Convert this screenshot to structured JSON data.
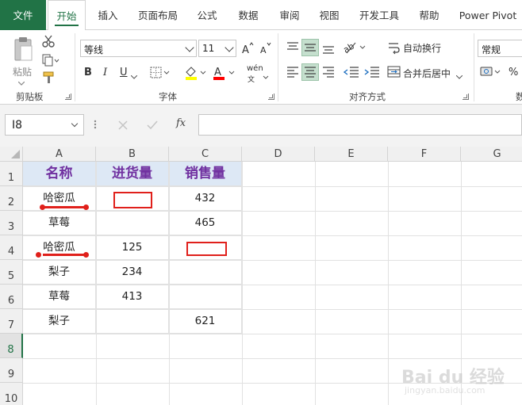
{
  "tabs": [
    {
      "label": "文件",
      "state": "file"
    },
    {
      "label": "开始",
      "state": "active"
    },
    {
      "label": "插入"
    },
    {
      "label": "页面布局"
    },
    {
      "label": "公式"
    },
    {
      "label": "数据"
    },
    {
      "label": "审阅"
    },
    {
      "label": "视图"
    },
    {
      "label": "开发工具"
    },
    {
      "label": "帮助"
    },
    {
      "label": "Power Pivot"
    }
  ],
  "ribbon": {
    "clipboard": {
      "paste_label": "粘贴",
      "group_label": "剪贴板"
    },
    "font": {
      "font_name": "等线",
      "font_size": "11",
      "group_label": "字体",
      "bold": "B",
      "italic": "I",
      "underline": "U",
      "phonetic": "wén"
    },
    "alignment": {
      "wrap_text": "自动换行",
      "merge_center": "合并后居中",
      "group_label": "对齐方式"
    },
    "number": {
      "format": "常规",
      "group_label_partial": "数",
      "percent": "%"
    }
  },
  "formula_bar": {
    "name_box": "I8",
    "fx": "fx",
    "formula": ""
  },
  "columns": [
    "A",
    "B",
    "C",
    "D",
    "E",
    "F",
    "G"
  ],
  "rows": [
    "1",
    "2",
    "3",
    "4",
    "5",
    "6",
    "7",
    "8",
    "9",
    "10"
  ],
  "selected_row": "8",
  "sheet": {
    "header": {
      "a": "名称",
      "b": "进货量",
      "c": "销售量"
    },
    "rows": [
      {
        "a": "哈密瓜",
        "b": "",
        "c": "432"
      },
      {
        "a": "草莓",
        "b": "",
        "c": "465"
      },
      {
        "a": "哈密瓜",
        "b": "125",
        "c": ""
      },
      {
        "a": "梨子",
        "b": "234",
        "c": ""
      },
      {
        "a": "草莓",
        "b": "413",
        "c": ""
      },
      {
        "a": "梨子",
        "b": "",
        "c": "621"
      }
    ]
  },
  "watermark": {
    "main": "Bai du 经验",
    "sub": "jingyan.baidu.com"
  },
  "colors": {
    "accent": "#217346",
    "header_fill": "#dde8f5",
    "header_text": "#7030a0",
    "annotation_red": "#e0201b"
  }
}
